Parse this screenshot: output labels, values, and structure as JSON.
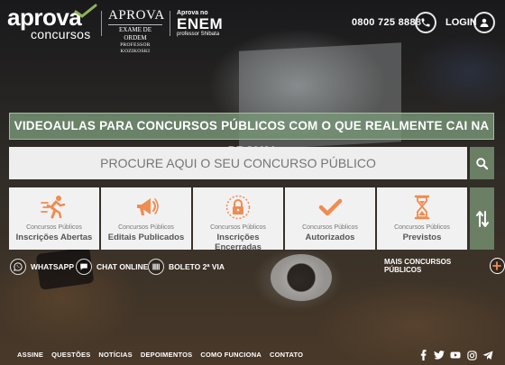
{
  "header": {
    "logo_word": "aprova",
    "logo_sub": "concursos",
    "oab": {
      "title": "APROVA",
      "line2": "EXAME DE ORDEM",
      "line3": "PROFESSOR KOZIKOSKI"
    },
    "enem": {
      "line1": "Aprova no",
      "title": "ENEM",
      "line3": "professor Shibata"
    },
    "phone": "0800 725 8888",
    "login": "LOGIN"
  },
  "tagline": "VIDEOAULAS PARA CONCURSOS PÚBLICOS COM O QUE REALMENTE CAI NA PROVA!",
  "search": {
    "placeholder": "PROCURE AQUI O SEU CONCURSO PÚBLICO"
  },
  "cards": [
    {
      "prefix": "Concursos Públicos",
      "title": "Inscrições Abertas",
      "icon": "running-person-icon"
    },
    {
      "prefix": "Concursos Públicos",
      "title": "Editais Publicados",
      "icon": "megaphone-icon"
    },
    {
      "prefix": "Concursos Públicos",
      "title": "Inscrições Encerradas",
      "icon": "padlock-icon"
    },
    {
      "prefix": "Concursos Públicos",
      "title": "Autorizados",
      "icon": "checkmark-icon"
    },
    {
      "prefix": "Concursos Públicos",
      "title": "Previstos",
      "icon": "hourglass-icon"
    }
  ],
  "quick_links": {
    "whatsapp": "WHATSAPP",
    "chat": "CHAT ONLINE",
    "boleto": "BOLETO 2ª VIA",
    "more": "MAIS CONCURSOS PÚBLICOS"
  },
  "footer": {
    "links": [
      "ASSINE",
      "QUESTÕES",
      "NOTÍCIAS",
      "DEPOIMENTOS",
      "COMO FUNCIONA",
      "CONTATO"
    ],
    "social": [
      "facebook-icon",
      "twitter-icon",
      "youtube-icon",
      "instagram-icon",
      "telegram-icon"
    ]
  },
  "colors": {
    "accent_green": "#6a7f64",
    "banner_green": "#7a9678",
    "icon_orange": "#f08c50",
    "card_bg": "#f1f1f1"
  }
}
